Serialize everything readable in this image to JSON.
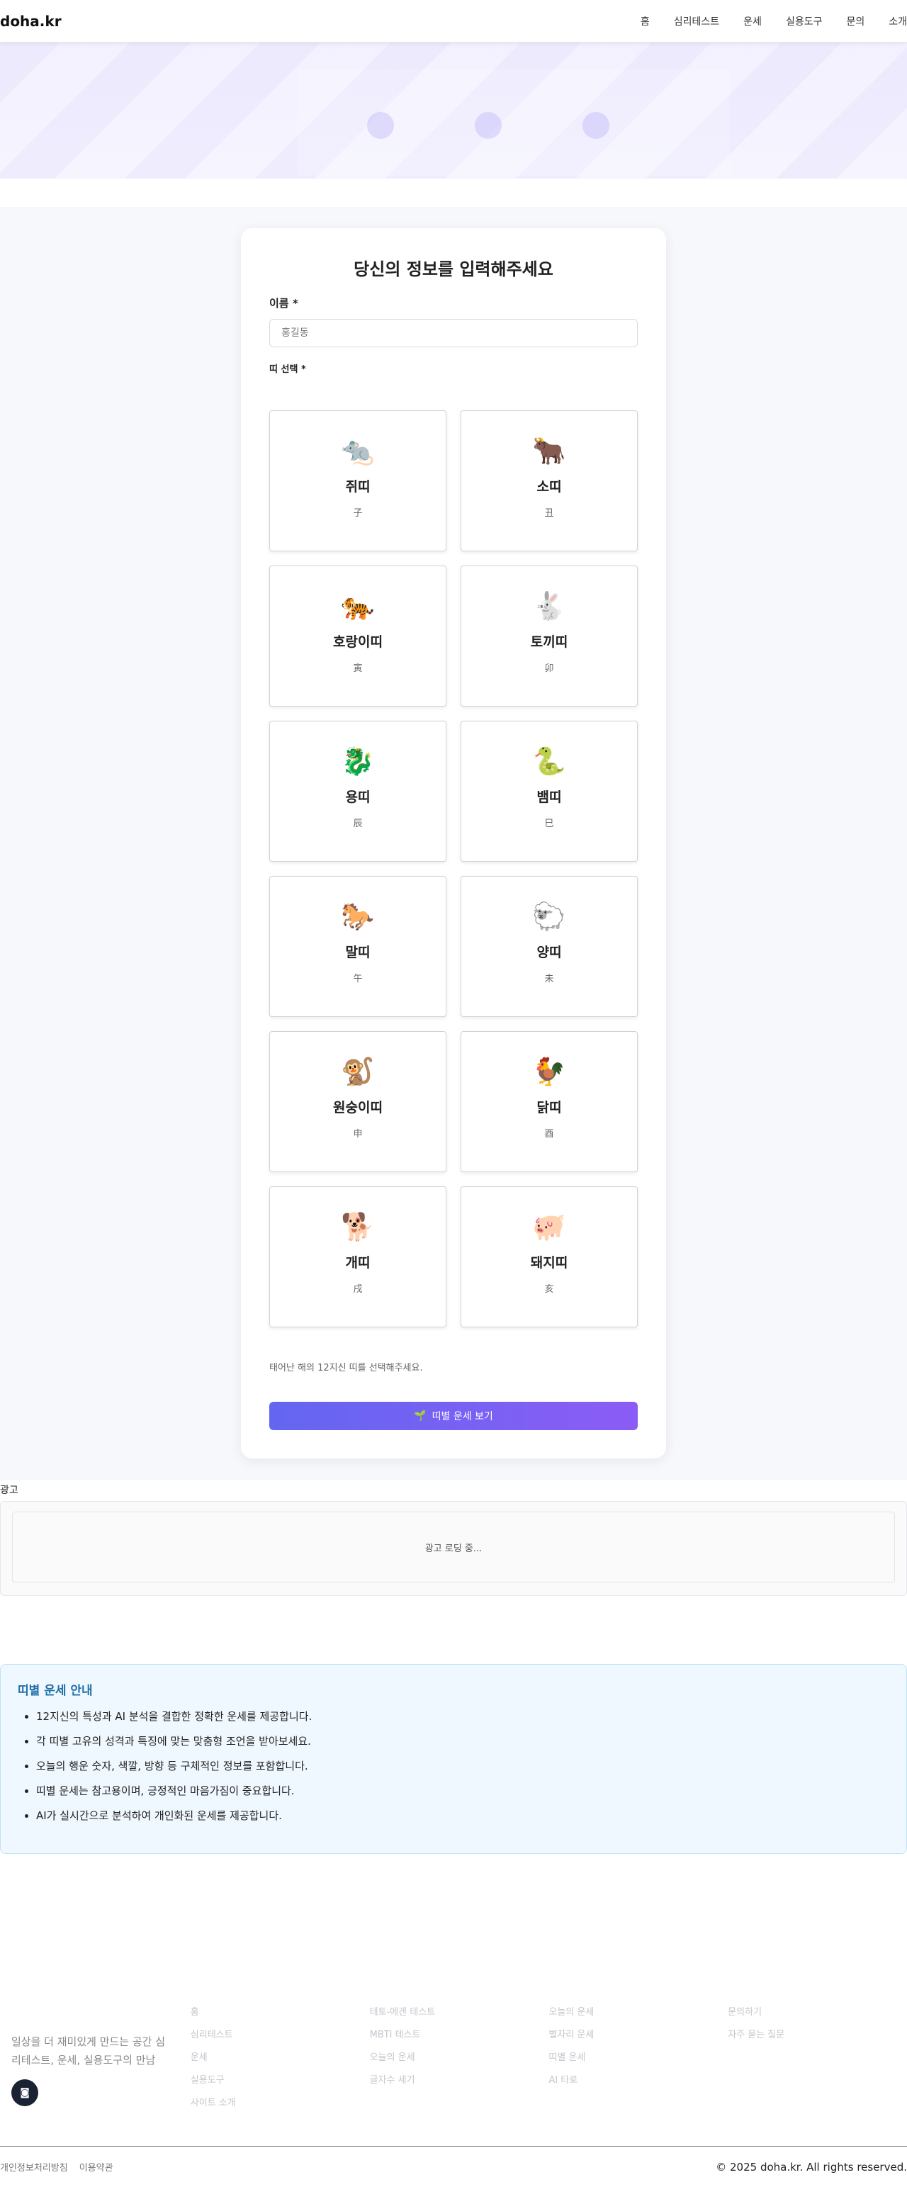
{
  "header": {
    "logo": "doha.kr",
    "nav": [
      "홈",
      "심리테스트",
      "운세",
      "실용도구",
      "문의",
      "소개"
    ]
  },
  "form": {
    "title": "당신의 정보를 입력해주세요",
    "name_label": "이름",
    "name_placeholder": "홍길동",
    "zodiac_label": "띠 선택",
    "required_mark": "*",
    "zodiacs": [
      {
        "icon": "🐀",
        "name": "쥐띠",
        "hanja": "子"
      },
      {
        "icon": "🐂",
        "name": "소띠",
        "hanja": "丑"
      },
      {
        "icon": "🐅",
        "name": "호랑이띠",
        "hanja": "寅"
      },
      {
        "icon": "🐇",
        "name": "토끼띠",
        "hanja": "卯"
      },
      {
        "icon": "🐉",
        "name": "용띠",
        "hanja": "辰"
      },
      {
        "icon": "🐍",
        "name": "뱀띠",
        "hanja": "巳"
      },
      {
        "icon": "🐎",
        "name": "말띠",
        "hanja": "午"
      },
      {
        "icon": "🐑",
        "name": "양띠",
        "hanja": "未"
      },
      {
        "icon": "🐒",
        "name": "원숭이띠",
        "hanja": "申"
      },
      {
        "icon": "🐓",
        "name": "닭띠",
        "hanja": "酉"
      },
      {
        "icon": "🐕",
        "name": "개띠",
        "hanja": "戌"
      },
      {
        "icon": "🐖",
        "name": "돼지띠",
        "hanja": "亥"
      }
    ],
    "hint": "태어난 해의 12지신 띠를 선택해주세요.",
    "submit_icon": "🌱",
    "submit_label": "띠별 운세 보기"
  },
  "ad": {
    "label": "광고",
    "loading": "광고 로딩 중..."
  },
  "info": {
    "title": "띠별 운세 안내",
    "items": [
      "12지신의 특성과 AI 분석을 결합한 정확한 운세를 제공합니다.",
      "각 띠별 고유의 성격과 특징에 맞는 맞춤형 조언을 받아보세요.",
      "오늘의 행운 숫자, 색깔, 방향 등 구체적인 정보를 포함합니다.",
      "띠별 운세는 참고용이며, 긍정적인 마음가짐이 중요합니다.",
      "AI가 실시간으로 분석하여 개인화된 운세를 제공합니다."
    ]
  },
  "footer": {
    "tagline": "일상을 더 재미있게 만드는 공간 심리테스트, 운세, 실용도구의 만남",
    "columns": [
      [
        "홈",
        "심리테스트",
        "운세",
        "실용도구",
        "사이트 소개"
      ],
      [
        "테토-에겐 테스트",
        "MBTI 테스트",
        "오늘의 운세",
        "글자수 세기"
      ],
      [
        "오늘의 운세",
        "별자리 운세",
        "띠별 운세",
        "AI 타로"
      ],
      [
        "문의하기",
        "자주 묻는 질문"
      ]
    ],
    "legal": [
      "개인정보처리방침",
      "이용약관"
    ],
    "copyright": "© 2025 doha.kr. All rights reserved."
  }
}
